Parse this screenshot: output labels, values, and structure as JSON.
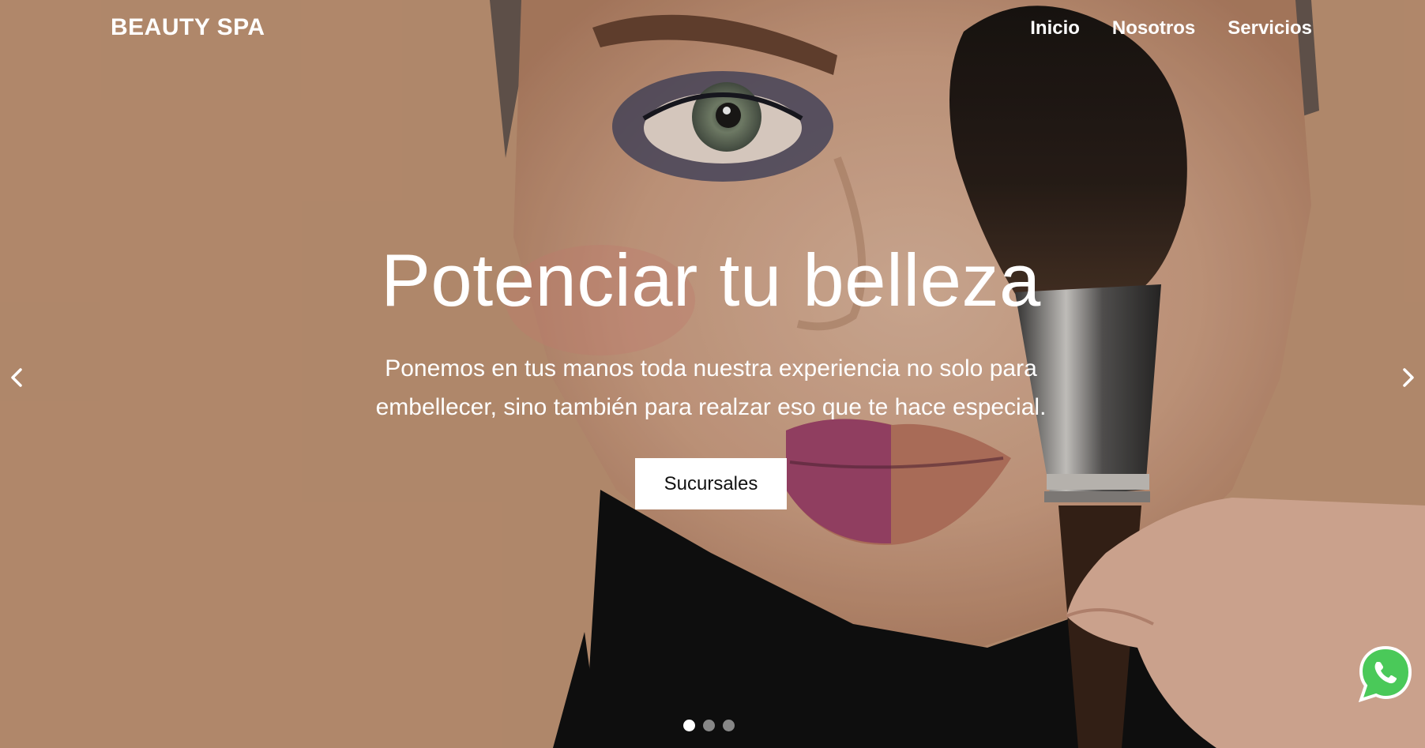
{
  "header": {
    "brand": "BEAUTY SPA",
    "nav": [
      "Inicio",
      "Nosotros",
      "Servicios"
    ]
  },
  "hero": {
    "title": "Potenciar tu belleza",
    "subtitle": "Ponemos en tus manos toda nuestra experiencia no solo para embellecer, sino también para realzar eso que te hace especial.",
    "button_label": "Sucursales",
    "slides_count": 3,
    "active_slide": 1
  },
  "icons": {
    "prev": "chevron-left-icon",
    "next": "chevron-right-icon",
    "whatsapp": "whatsapp-icon"
  },
  "colors": {
    "background": "#c89a79",
    "accent": "#ffffff",
    "whatsapp": "#4ac959"
  }
}
